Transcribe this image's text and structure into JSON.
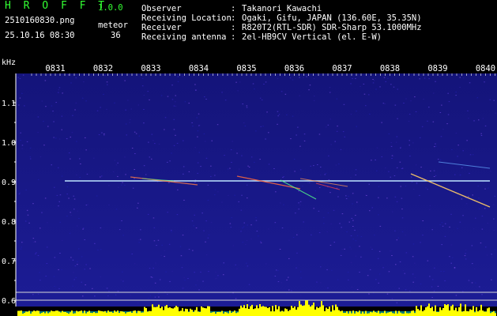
{
  "app": {
    "name": "H R O F F T",
    "version": "1.0.0"
  },
  "file": {
    "name": "2510160830.png",
    "datetime": "25.10.16 08:30"
  },
  "counter": {
    "label": "meteor",
    "value": "36"
  },
  "info": [
    {
      "key": "Observer",
      "sep": ":",
      "value": "Takanori Kawachi"
    },
    {
      "key": "Receiving Location",
      "sep": ":",
      "value": "Ogaki, Gifu, JAPAN (136.60E, 35.35N)"
    },
    {
      "key": "Receiver",
      "sep": ":",
      "value": "R820T2(RTL-SDR) SDR-Sharp 53.1000MHz"
    },
    {
      "key": "Receiving antenna",
      "sep": ":",
      "value": "2el-HB9CV Vertical (el. E-W)"
    }
  ],
  "spectrogram": {
    "y_unit": "kHz",
    "y_ticks": [
      "1.1",
      "1.0",
      "0.9",
      "0.8",
      "0.7",
      "0.6"
    ],
    "x_ticks": [
      "0831",
      "0832",
      "0833",
      "0834",
      "0835",
      "0836",
      "0837",
      "0838",
      "0839",
      "0840"
    ],
    "colors": {
      "background": "#000000",
      "noise": "#1a1a8c",
      "carrier": "#bfe6ff",
      "trace": "#ff6a3d",
      "level": "#ffff00",
      "axis": "#ffffff"
    }
  }
}
